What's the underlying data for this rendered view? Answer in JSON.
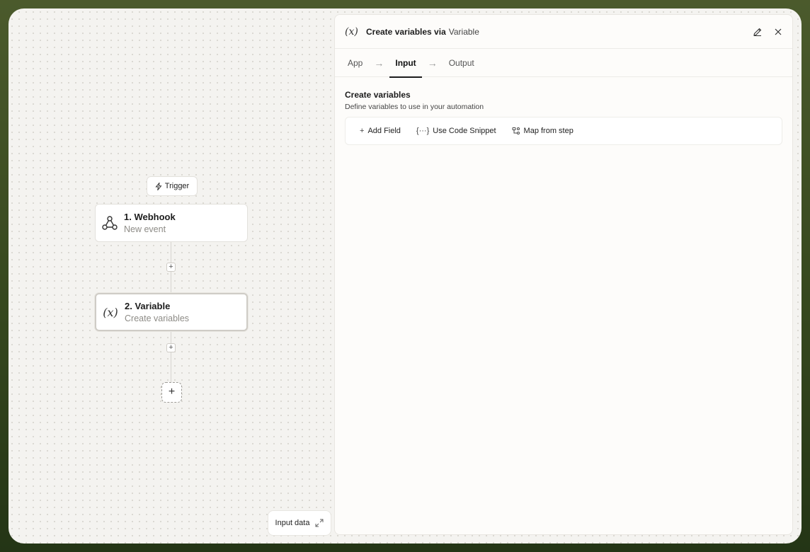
{
  "canvas": {
    "trigger_label": "Trigger",
    "nodes": [
      {
        "title": "1. Webhook",
        "subtitle": "New event",
        "icon": "webhook-icon"
      },
      {
        "title": "2. Variable",
        "subtitle": "Create variables",
        "icon": "variable-icon",
        "icon_glyph": "(x)"
      }
    ],
    "input_data_label": "Input data"
  },
  "panel": {
    "icon_glyph": "(x)",
    "title": "Create variables via",
    "app_name": "Variable",
    "tabs": [
      {
        "label": "App",
        "active": false
      },
      {
        "label": "Input",
        "active": true
      },
      {
        "label": "Output",
        "active": false
      }
    ],
    "section": {
      "title": "Create variables",
      "subtitle": "Define variables to use in your automation"
    },
    "toolbar": {
      "add_field": "Add Field",
      "code_snippet": "Use Code Snippet",
      "map_from_step": "Map from step"
    }
  },
  "colors": {
    "outer_bg": "#3f4f24",
    "canvas_bg": "#f4f3f0",
    "panel_bg": "#fdfcfa"
  }
}
